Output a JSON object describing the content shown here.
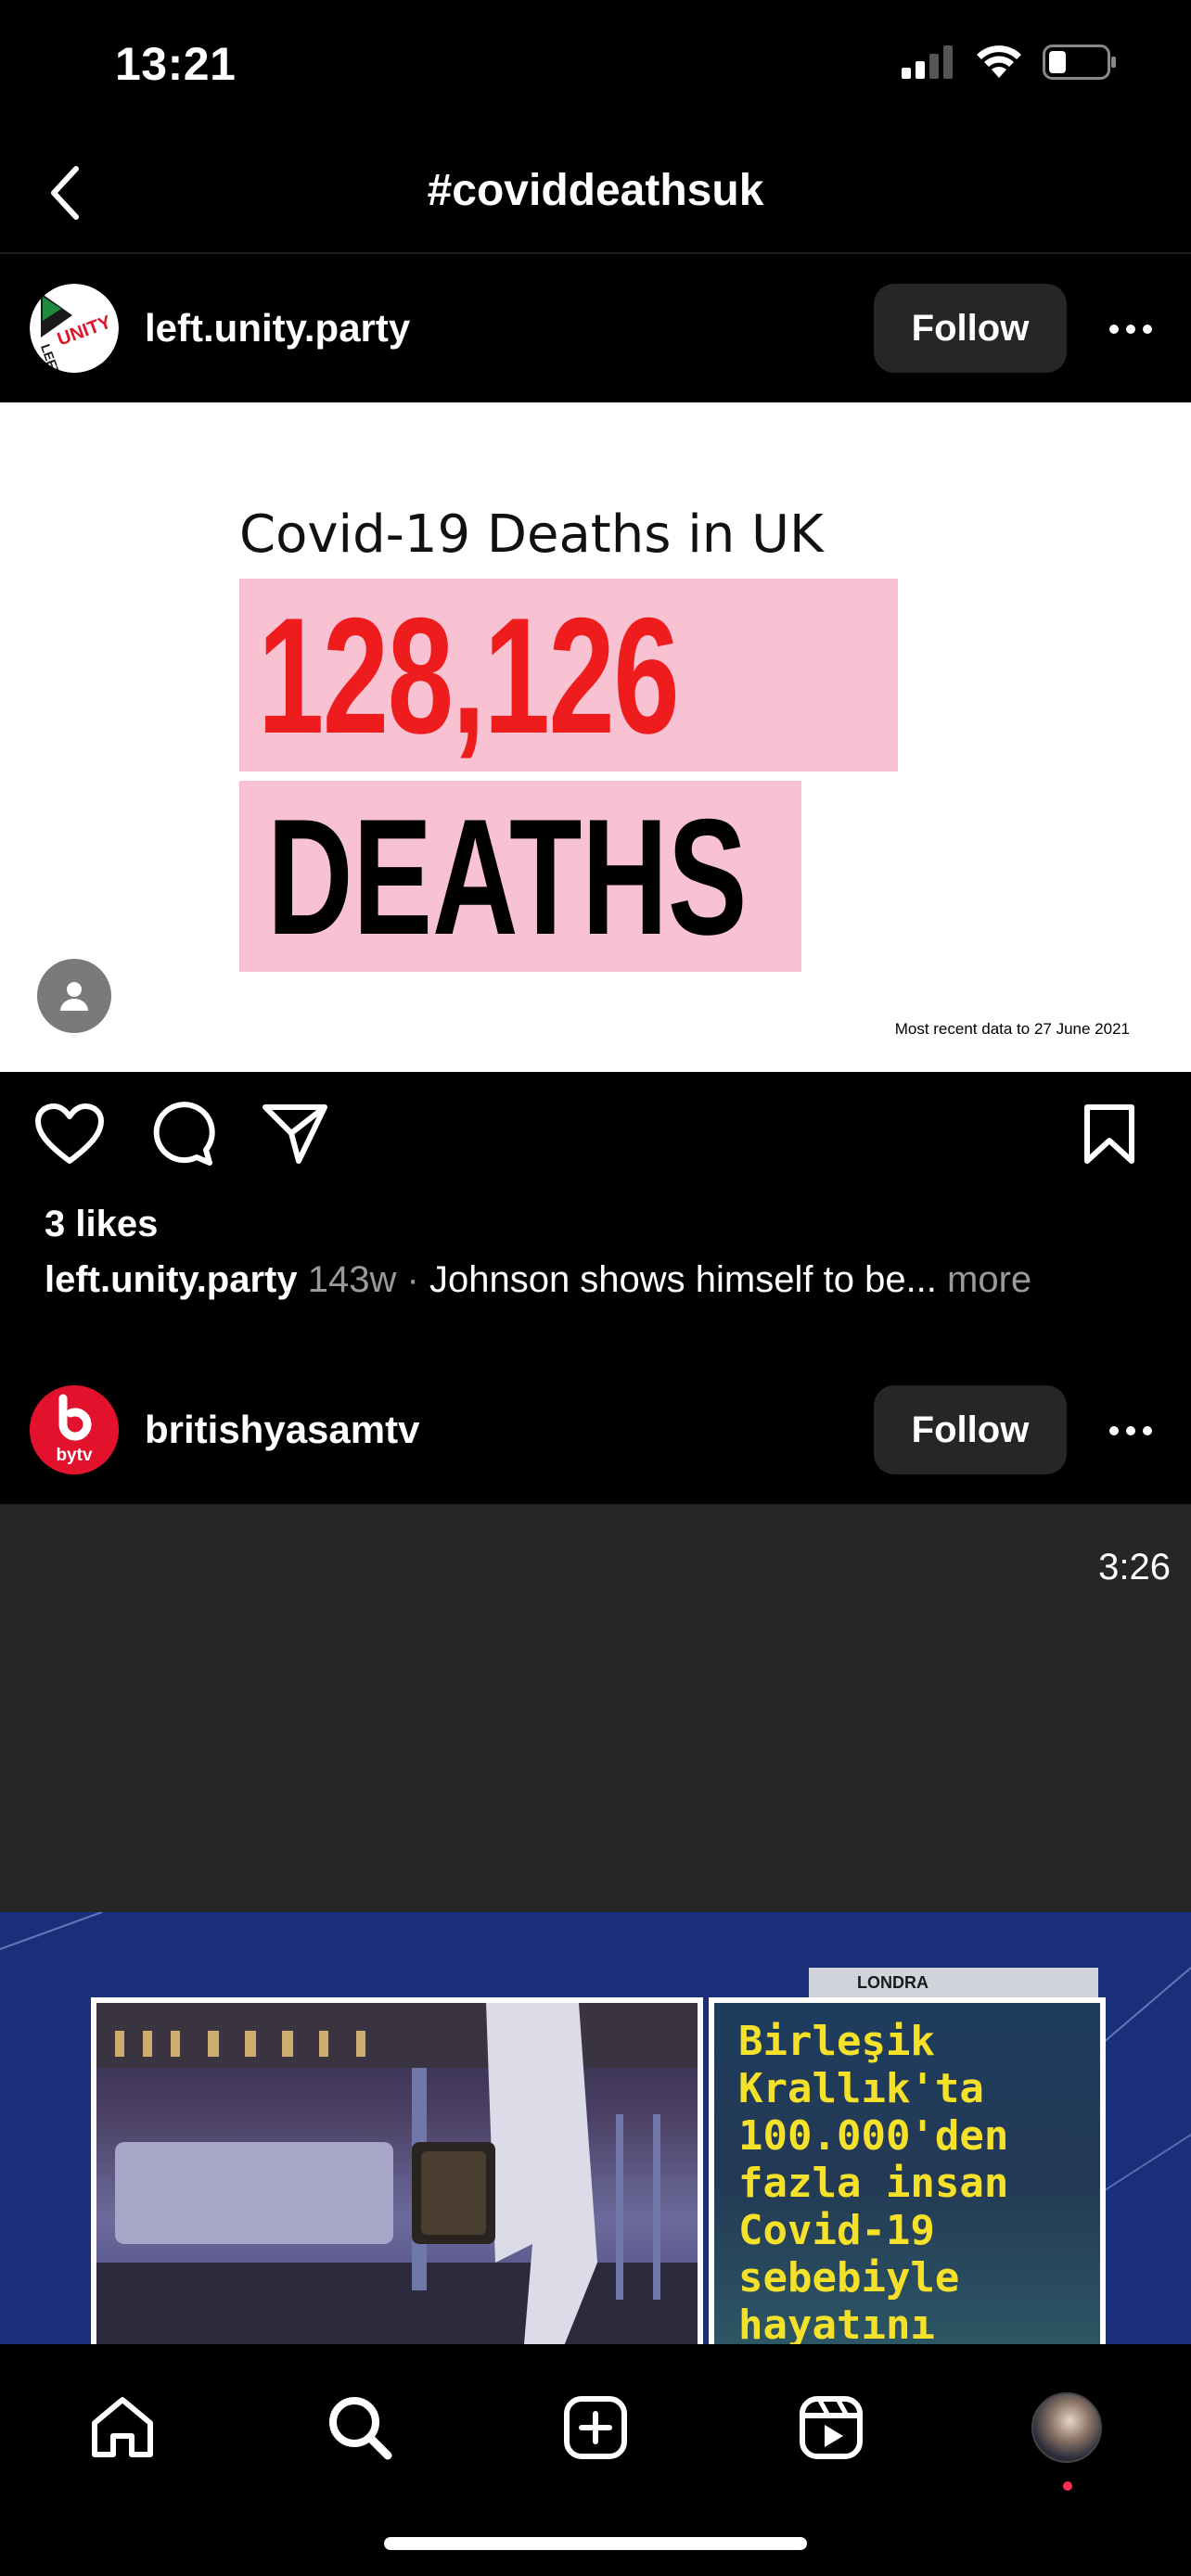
{
  "status_bar": {
    "time": "13:21"
  },
  "header": {
    "title": "#coviddeathsuk"
  },
  "post1": {
    "username": "left.unity.party",
    "avatar_text": "UNITY",
    "avatar_text2": "LEFT",
    "follow_label": "Follow",
    "image": {
      "title": "Covid-19 Deaths in UK",
      "number": "128,126",
      "word": "DEATHS",
      "footnote": "Most recent data to 27 June 2021"
    },
    "likes": "3 likes",
    "caption": {
      "username": "left.unity.party",
      "time": "143w",
      "separator": "·",
      "text": "Johnson shows himself to be...",
      "more": "more"
    }
  },
  "post2": {
    "username": "britishyasamtv",
    "avatar_text": "bytv",
    "follow_label": "Follow",
    "duration": "3:26",
    "thumbnail": {
      "location_tag": "LONDRA",
      "headline": "Birleşik Krallık'ta 100.000'den fazla insan Covid-19 sebebiyle hayatını"
    }
  },
  "colors": {
    "background": "#000000",
    "button": "#262626",
    "accent_red": "#ee1c1c",
    "pink_box": "#f9c2d2",
    "headline_yellow": "#f5e12a"
  },
  "tab_bar": {
    "icons": [
      "home-icon",
      "search-icon",
      "create-icon",
      "reels-icon",
      "profile-avatar"
    ]
  }
}
